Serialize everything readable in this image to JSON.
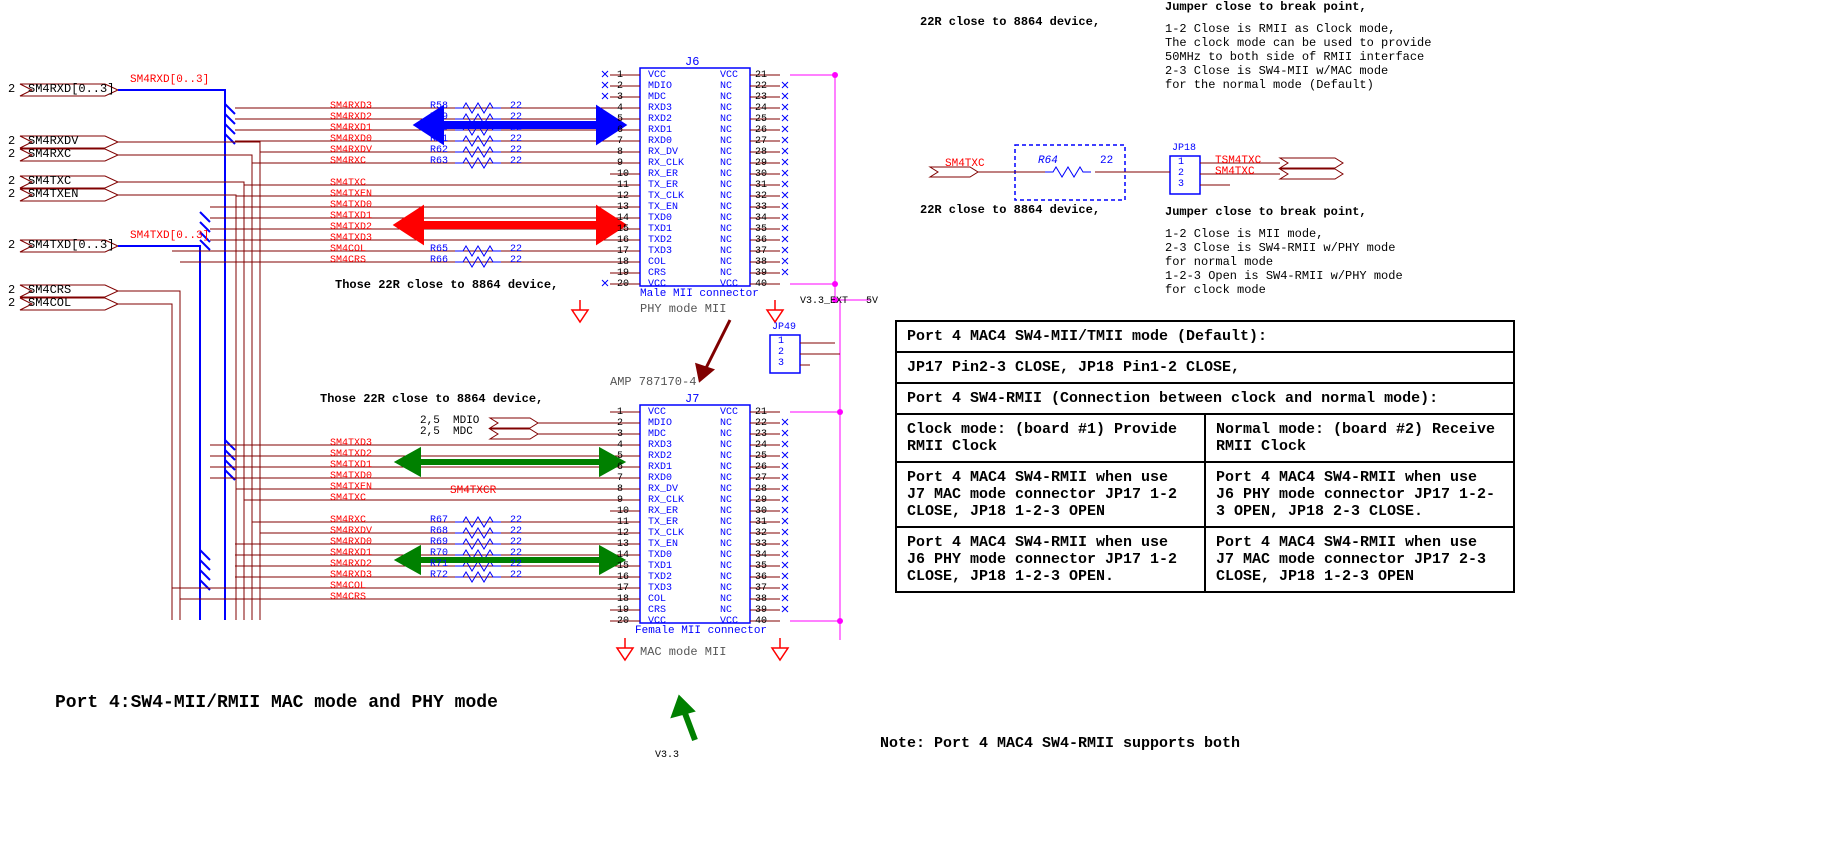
{
  "title": "Port 4:SW4-MII/RMII MAC mode and PHY mode",
  "notes": {
    "r_close_j6": "Those 22R close to 8864 device,",
    "r_close_j7": "Those 22R close to 8864 device,",
    "r_close_top": "22R close to 8864 device,",
    "r_close_bot": "22R close to 8864 device,",
    "phy_mode": "PHY mode MII",
    "mac_mode": "MAC mode MII",
    "amp": "AMP 787170-4",
    "v33ext": "V3.3_EXT",
    "v5": "5V",
    "v33": "V3.3",
    "mdio": "2,5  MDIO",
    "mdc": "2,5  MDC",
    "foot": "Note: Port 4 MAC4 SW4-RMII supports both"
  },
  "jp17_text": {
    "l1": "Jumper close to break point,",
    "l2": "1-2 Close is RMII as Clock mode,",
    "l3": "The clock mode can be used to provide",
    "l4": "50MHz to both side of RMII interface",
    "l5": "2-3 Close is SW4-MII w/MAC mode",
    "l6": "for the normal mode (Default)"
  },
  "jp18_text": {
    "l0": "Jumper close to break point,",
    "l1": "1-2 Close is MII mode,",
    "l2": "2-3 Close is SW4-RMII w/PHY mode",
    "l3": "for normal mode",
    "l4": "1-2-3 Open is SW4-RMII w/PHY mode",
    "l5": "for clock mode"
  },
  "cfg": {
    "r1": "Port 4 MAC4 SW4-MII/TMII mode (Default):",
    "r2": "JP17 Pin2-3 CLOSE,  JP18 Pin1-2 CLOSE,",
    "r3": "Port 4 SW4-RMII (Connection between clock and normal mode):",
    "r4a": "Clock mode: (board #1)\nProvide RMII Clock",
    "r4b": "Normal mode: (board #2)\nReceive RMII Clock",
    "r5a": "Port 4 MAC4 SW4-RMII when\nuse J7 MAC mode connector\nJP17 1-2 CLOSE,\nJP18 1-2-3 OPEN",
    "r5b": "Port 4 MAC4 SW4-RMII when\nuse J6 PHY mode connector\nJP17 1-2-3 OPEN,\nJP18 2-3 CLOSE.",
    "r6a": "Port 4 MAC4 SW4-RMII when\nuse J6 PHY mode connector\nJP17 1-2 CLOSE,\nJP18 1-2-3 OPEN.",
    "r6b": "Port 4 MAC4 SW4-RMII when\nuse J7 MAC mode connector\nJP17 2-3 CLOSE,\nJP18 1-2-3 OPEN"
  },
  "ports_left": [
    {
      "pg": "2",
      "name": "SM4RXD[0..3]"
    },
    {
      "pg": "2",
      "name": "SM4RXDV"
    },
    {
      "pg": "2",
      "name": "SM4RXC"
    },
    {
      "pg": "2",
      "name": "SM4TXC"
    },
    {
      "pg": "2",
      "name": "SM4TXEN"
    },
    {
      "pg": "2",
      "name": "SM4TXD[0..3]"
    },
    {
      "pg": "2",
      "name": "SM4CRS"
    },
    {
      "pg": "2",
      "name": "SM4COL"
    }
  ],
  "bus_labels": {
    "rxd": "SM4RXD[0..3]",
    "txd": "SM4TXD[0..3]"
  },
  "nets_j6": [
    "SM4RXD3",
    "SM4RXD2",
    "SM4RXD1",
    "SM4RXD0",
    "SM4RXDV",
    "SM4RXC",
    "SM4TXC",
    "SM4TXEN",
    "SM4TXD0",
    "SM4TXD1",
    "SM4TXD2",
    "SM4TXD3",
    "SM4COL",
    "SM4CRS"
  ],
  "nets_j7_top": [
    "SM4TXD3",
    "SM4TXD2",
    "SM4TXD1",
    "SM4TXD0",
    "SM4TXEN",
    "SM4TXC"
  ],
  "net_txcr": "SM4TXCR",
  "nets_j7_bot": [
    "SM4RXC",
    "SM4RXDV",
    "SM4RXD0",
    "SM4RXD1",
    "SM4RXD2",
    "SM4RXD3",
    "SM4COL",
    "SM4CRS"
  ],
  "res_j6": [
    {
      "ref": "R58",
      "val": "22"
    },
    {
      "ref": "R59",
      "val": "22"
    },
    {
      "ref": "R60",
      "val": "22"
    },
    {
      "ref": "R61",
      "val": "22"
    },
    {
      "ref": "R62",
      "val": "22"
    },
    {
      "ref": "R63",
      "val": "22"
    }
  ],
  "res_j6b": [
    {
      "ref": "R65",
      "val": "22"
    },
    {
      "ref": "R66",
      "val": "22"
    }
  ],
  "res_j7": [
    {
      "ref": "R67",
      "val": "22"
    },
    {
      "ref": "R68",
      "val": "22"
    },
    {
      "ref": "R69",
      "val": "22"
    },
    {
      "ref": "R70",
      "val": "22"
    },
    {
      "ref": "R71",
      "val": "22"
    },
    {
      "ref": "R72",
      "val": "22"
    }
  ],
  "res_top": {
    "ref": "R64",
    "val": "22"
  },
  "jp18_nets": {
    "a": "TSM4TXC",
    "b": "SM4TXC",
    "c": "SM4TXC"
  },
  "connectors": {
    "j6": {
      "ref": "J6",
      "type": "Male MII connector"
    },
    "j7": {
      "ref": "J7",
      "type": "Female MII connector"
    },
    "jp49": {
      "ref": "JP49"
    },
    "jp18": {
      "ref": "JP18"
    }
  },
  "conn_pins": {
    "left_names": [
      "VCC",
      "MDIO",
      "MDC",
      "RXD3",
      "RXD2",
      "RXD1",
      "RXD0",
      "RX_DV",
      "RX_CLK",
      "RX_ER",
      "TX_ER",
      "TX_CLK",
      "TX_EN",
      "TXD0",
      "TXD1",
      "TXD2",
      "TXD3",
      "COL",
      "CRS",
      "VCC"
    ],
    "left_nums": [
      "1",
      "2",
      "3",
      "4",
      "5",
      "6",
      "7",
      "8",
      "9",
      "10",
      "11",
      "12",
      "13",
      "14",
      "15",
      "16",
      "17",
      "18",
      "19",
      "20"
    ],
    "right_names": [
      "VCC",
      "NC",
      "NC",
      "NC",
      "NC",
      "NC",
      "NC",
      "NC",
      "NC",
      "NC",
      "NC",
      "NC",
      "NC",
      "NC",
      "NC",
      "NC",
      "NC",
      "NC",
      "NC",
      "VCC"
    ],
    "right_nums": [
      "21",
      "22",
      "23",
      "24",
      "25",
      "26",
      "27",
      "28",
      "29",
      "30",
      "31",
      "32",
      "33",
      "34",
      "35",
      "36",
      "37",
      "38",
      "39",
      "40"
    ]
  },
  "jp_pins": [
    "1",
    "2",
    "3"
  ]
}
